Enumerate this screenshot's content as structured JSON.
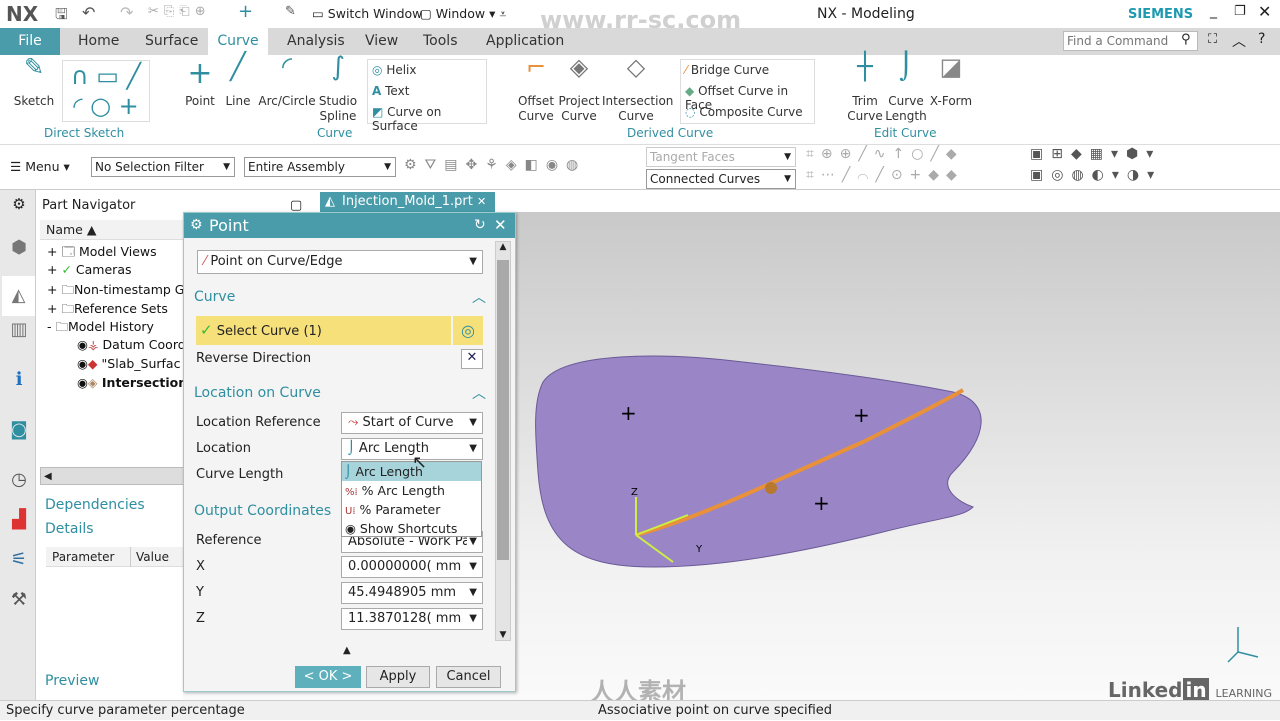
{
  "title_bar": {
    "logo": "NX",
    "quick_access": [
      "save-icon",
      "undo-icon",
      "redo-icon",
      "cut-icon",
      "copy-icon",
      "paste-icon",
      "repeat-icon",
      "add-icon",
      "touch-mode-icon"
    ],
    "switch_window": "Switch Window",
    "window": "Window",
    "title": "NX - Modeling",
    "brand": "SIEMENS",
    "watermark": "www.rr-sc.com"
  },
  "tabs": {
    "file": "File",
    "items": [
      "Home",
      "Surface",
      "Curve",
      "Analysis",
      "View",
      "Tools",
      "Application"
    ],
    "active": "Curve"
  },
  "search": {
    "placeholder": "Find a Command"
  },
  "ribbon": {
    "direct_sketch": {
      "sketch": "Sketch",
      "label": "Direct Sketch"
    },
    "curve": {
      "point": "Point",
      "line": "Line",
      "arc": "Arc/Circle",
      "studio": "Studio",
      "spline": "Spline",
      "helix": "Helix",
      "text": "Text",
      "curve_on_surface": "Curve on Surface",
      "label": "Curve"
    },
    "derived": {
      "offset1": "Offset",
      "offset2": "Curve",
      "project1": "Project",
      "project2": "Curve",
      "inter1": "Intersection",
      "inter2": "Curve",
      "bridge": "Bridge Curve",
      "offset_face": "Offset Curve in Face",
      "composite": "Composite Curve",
      "label": "Derived Curve"
    },
    "edit": {
      "trim1": "Trim",
      "trim2": "Curve",
      "len1": "Curve",
      "len2": "Length",
      "xform": "X-Form",
      "label": "Edit Curve"
    }
  },
  "toolbar": {
    "menu": "Menu",
    "selection_filter": "No Selection Filter",
    "scope": "Entire Assembly",
    "face_rule": "Tangent Faces",
    "curve_rule": "Connected Curves"
  },
  "navigator": {
    "title": "Part Navigator",
    "column": "Name",
    "items": [
      {
        "label": "Model Views"
      },
      {
        "label": "Cameras"
      },
      {
        "label": "Non-timestamp Ge"
      },
      {
        "label": "Reference Sets"
      },
      {
        "label": "Model History"
      },
      {
        "label": "Datum Coord"
      },
      {
        "label": "\"Slab_Surfac"
      },
      {
        "label": "Intersection"
      }
    ],
    "dependencies": "Dependencies",
    "details": "Details",
    "param_col": "Parameter",
    "value_col": "Value",
    "preview": "Preview"
  },
  "document_tab": {
    "label": "Injection_Mold_1.prt"
  },
  "point_dialog": {
    "title": "Point",
    "type": "Point on Curve/Edge",
    "curve_section": "Curve",
    "select_curve": "Select Curve (1)",
    "reverse": "Reverse Direction",
    "location_section": "Location on Curve",
    "location_reference_label": "Location Reference",
    "location_reference": "Start of Curve",
    "location_label": "Location",
    "location": "Arc Length",
    "curve_length_label": "Curve Length",
    "location_options": [
      "Arc Length",
      "% Arc Length",
      "% Parameter",
      "Show Shortcuts"
    ],
    "output_section": "Output Coordinates",
    "reference_label": "Reference",
    "reference": "Absolute - Work Par",
    "x_label": "X",
    "x": "0.00000000(",
    "y_label": "Y",
    "y": "45.4948905",
    "z_label": "Z",
    "z": "11.3870128(",
    "unit": "mm",
    "ok": "< OK >",
    "apply": "Apply",
    "cancel": "Cancel"
  },
  "viewport": {
    "axis_z": "Z",
    "axis_y": "Y",
    "colors": {
      "surface": "#9a86c6",
      "curve": "#e8913a"
    }
  },
  "status": {
    "left": "Specify curve parameter percentage",
    "center": "Associative point on curve specified"
  },
  "branding": {
    "linkedin": "Linked",
    "in": "in",
    "learning": "LEARNING",
    "cn_logo": "人人素材"
  }
}
